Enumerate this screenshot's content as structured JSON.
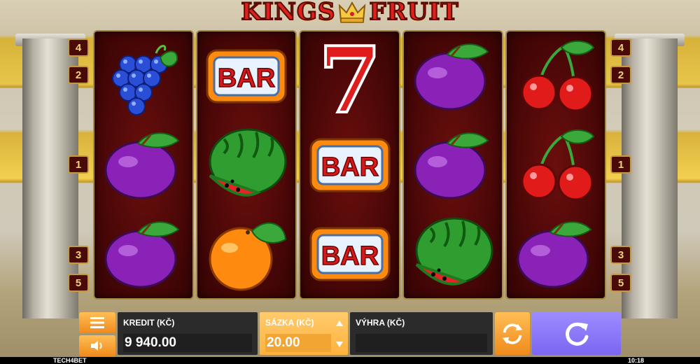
{
  "logo": {
    "word_left": "KINGS",
    "word_right": "FRUIT"
  },
  "paylines": {
    "left": [
      "4",
      "2",
      "1",
      "3",
      "5"
    ],
    "right": [
      "4",
      "2",
      "1",
      "3",
      "5"
    ]
  },
  "reels": [
    [
      "grapes",
      "plum",
      "plum"
    ],
    [
      "bar",
      "watermelon",
      "orange"
    ],
    [
      "seven",
      "bar",
      "bar"
    ],
    [
      "plum",
      "plum",
      "watermelon"
    ],
    [
      "cherries",
      "cherries",
      "plum"
    ]
  ],
  "symbol_text": {
    "bar": "BAR",
    "seven": "7"
  },
  "controls": {
    "menu_icon": "hamburger-menu-icon",
    "sound_icon": "speaker-icon",
    "credit_label": "KREDIT (KČ)",
    "credit_value": "9 940.00",
    "bet_label": "SÁZKA (KČ)",
    "bet_value": "20.00",
    "win_label": "VÝHRA (KČ)",
    "win_value": "",
    "autoplay_icon": "autoplay-cycle-icon",
    "spin_icon": "spin-icon"
  },
  "footer": {
    "brand": "TECH4BET",
    "clock": "10:18"
  },
  "colors": {
    "orange_button": "#f5a033",
    "spin_button": "#8a78f7",
    "reel_background": "#4a0707",
    "logo_red": "#e0201b"
  }
}
